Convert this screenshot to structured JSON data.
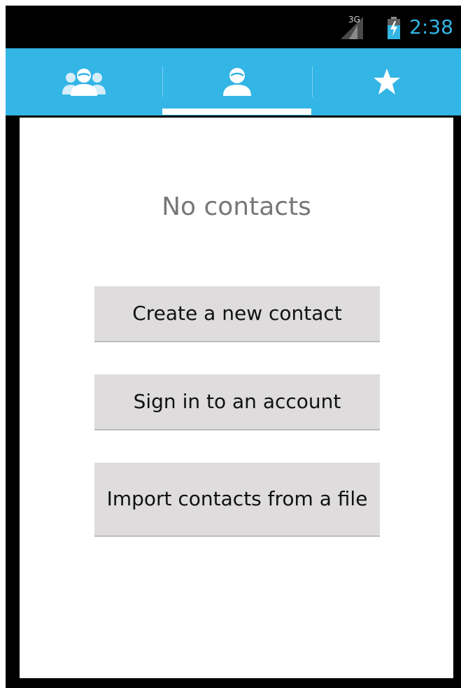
{
  "status_bar": {
    "network": "3G",
    "time": "2:38",
    "time_color": "#33b5e5"
  },
  "tabs": [
    {
      "icon": "groups-icon",
      "selected": false
    },
    {
      "icon": "person-icon",
      "selected": true
    },
    {
      "icon": "star-icon",
      "selected": false
    }
  ],
  "theme": {
    "accent": "#33b5e5",
    "button_bg": "#dedcdd"
  },
  "empty_state": {
    "message": "No contacts"
  },
  "actions": {
    "create_label": "Create a new contact",
    "signin_label": "Sign in to an account",
    "import_label": "Import contacts from a file"
  }
}
